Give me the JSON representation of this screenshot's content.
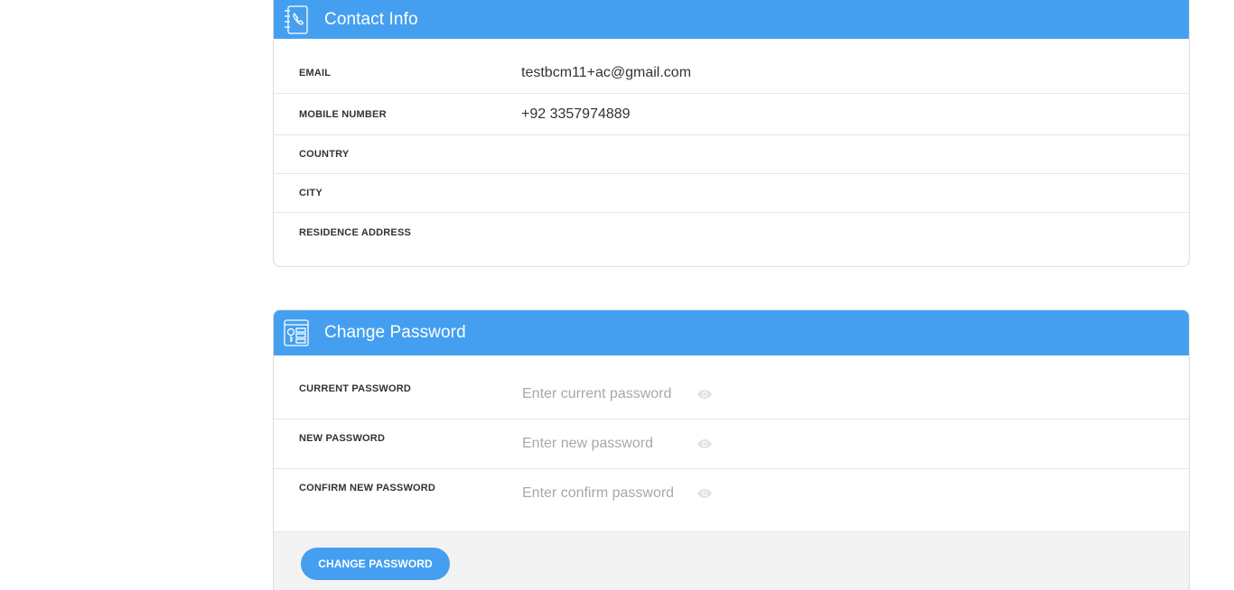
{
  "contact": {
    "title": "Contact Info",
    "icon": "phone-book-icon",
    "fields": [
      {
        "label": "EMAIL",
        "value": "testbcm11+ac@gmail.com"
      },
      {
        "label": "MOBILE NUMBER",
        "value": "+92 3357974889"
      },
      {
        "label": "COUNTRY",
        "value": ""
      },
      {
        "label": "CITY",
        "value": ""
      },
      {
        "label": "RESIDENCE ADDRESS",
        "value": ""
      }
    ]
  },
  "password": {
    "title": "Change Password",
    "icon": "password-key-icon",
    "fields": [
      {
        "label": "CURRENT PASSWORD",
        "placeholder": "Enter current password",
        "icon": "eye-icon"
      },
      {
        "label": "NEW PASSWORD",
        "placeholder": "Enter new password",
        "icon": "eye-icon"
      },
      {
        "label": "CONFIRM NEW PASSWORD",
        "placeholder": "Enter confirm password",
        "icon": "eye-icon"
      }
    ],
    "button_label": "CHANGE PASSWORD"
  },
  "colors": {
    "accent": "#449ff0",
    "footer_bg": "#f3f3f3",
    "placeholder": "#a8a8a8"
  }
}
